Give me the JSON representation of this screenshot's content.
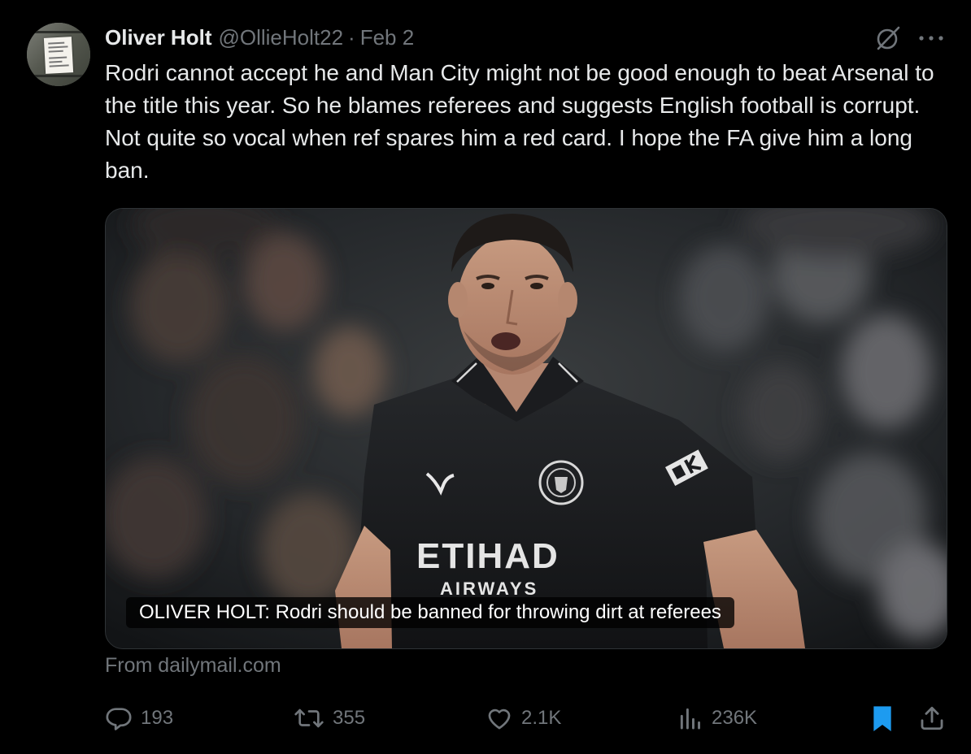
{
  "tweet": {
    "author_name": "Oliver Holt",
    "handle": "@OllieHolt22",
    "separator": "·",
    "date": "Feb 2",
    "text": "Rodri cannot accept he and Man City might not be good enough to beat Arsenal to the title this year. So he blames referees and suggests English football is corrupt. Not quite so vocal when ref spares him a red card. I hope the FA give him a long ban.",
    "card": {
      "caption": "OLIVER HOLT: Rodri should be banned for throwing dirt at referees",
      "source": "From dailymail.com"
    },
    "actions": {
      "replies": "193",
      "reposts": "355",
      "likes": "2.1K",
      "views": "236K"
    }
  },
  "colors": {
    "background": "#000000",
    "text": "#e7e9ea",
    "muted": "#71767b",
    "bookmark_active": "#1d9bf0"
  },
  "icons": [
    "grok-icon",
    "more-icon",
    "reply-icon",
    "repost-icon",
    "like-icon",
    "views-icon",
    "bookmark-icon",
    "share-icon"
  ]
}
